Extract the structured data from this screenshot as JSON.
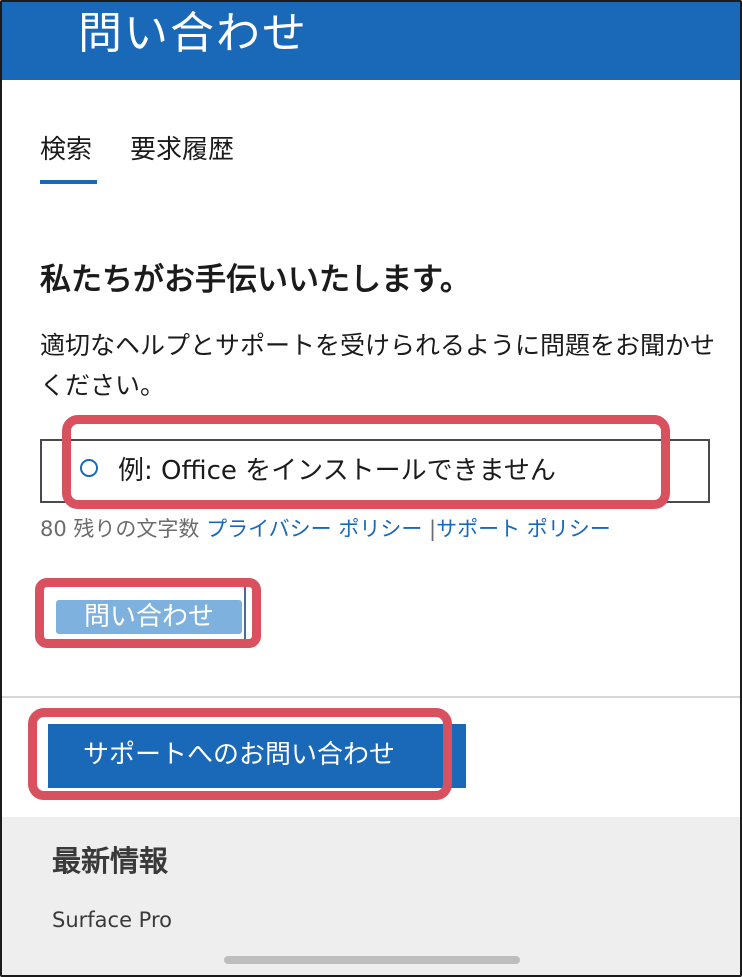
{
  "header": {
    "title": "問い合わせ"
  },
  "tabs": [
    {
      "label": "検索",
      "active": true
    },
    {
      "label": "要求履歴",
      "active": false
    }
  ],
  "main": {
    "heading": "私たちがお手伝いいたします。",
    "description": "適切なヘルプとサポートを受けられるように問題をお聞かせください。",
    "search": {
      "placeholder": "例: Office をインストールできません",
      "value": ""
    },
    "chars_left": "80 残りの文字数",
    "privacy_link": "プライバシー ポリシー",
    "separator": "|",
    "support_policy_link": "サポート ポリシー",
    "contact_button": "問い合わせ",
    "support_button": "サポートへのお問い合わせ"
  },
  "news": {
    "title": "最新情報",
    "items": [
      "Surface Pro"
    ]
  },
  "colors": {
    "brand": "#1a68b8",
    "highlight": "#d9505e",
    "contact_button_fill": "#7fb1de",
    "news_background": "#eeeeee"
  },
  "icons": {
    "search": "search-icon"
  }
}
